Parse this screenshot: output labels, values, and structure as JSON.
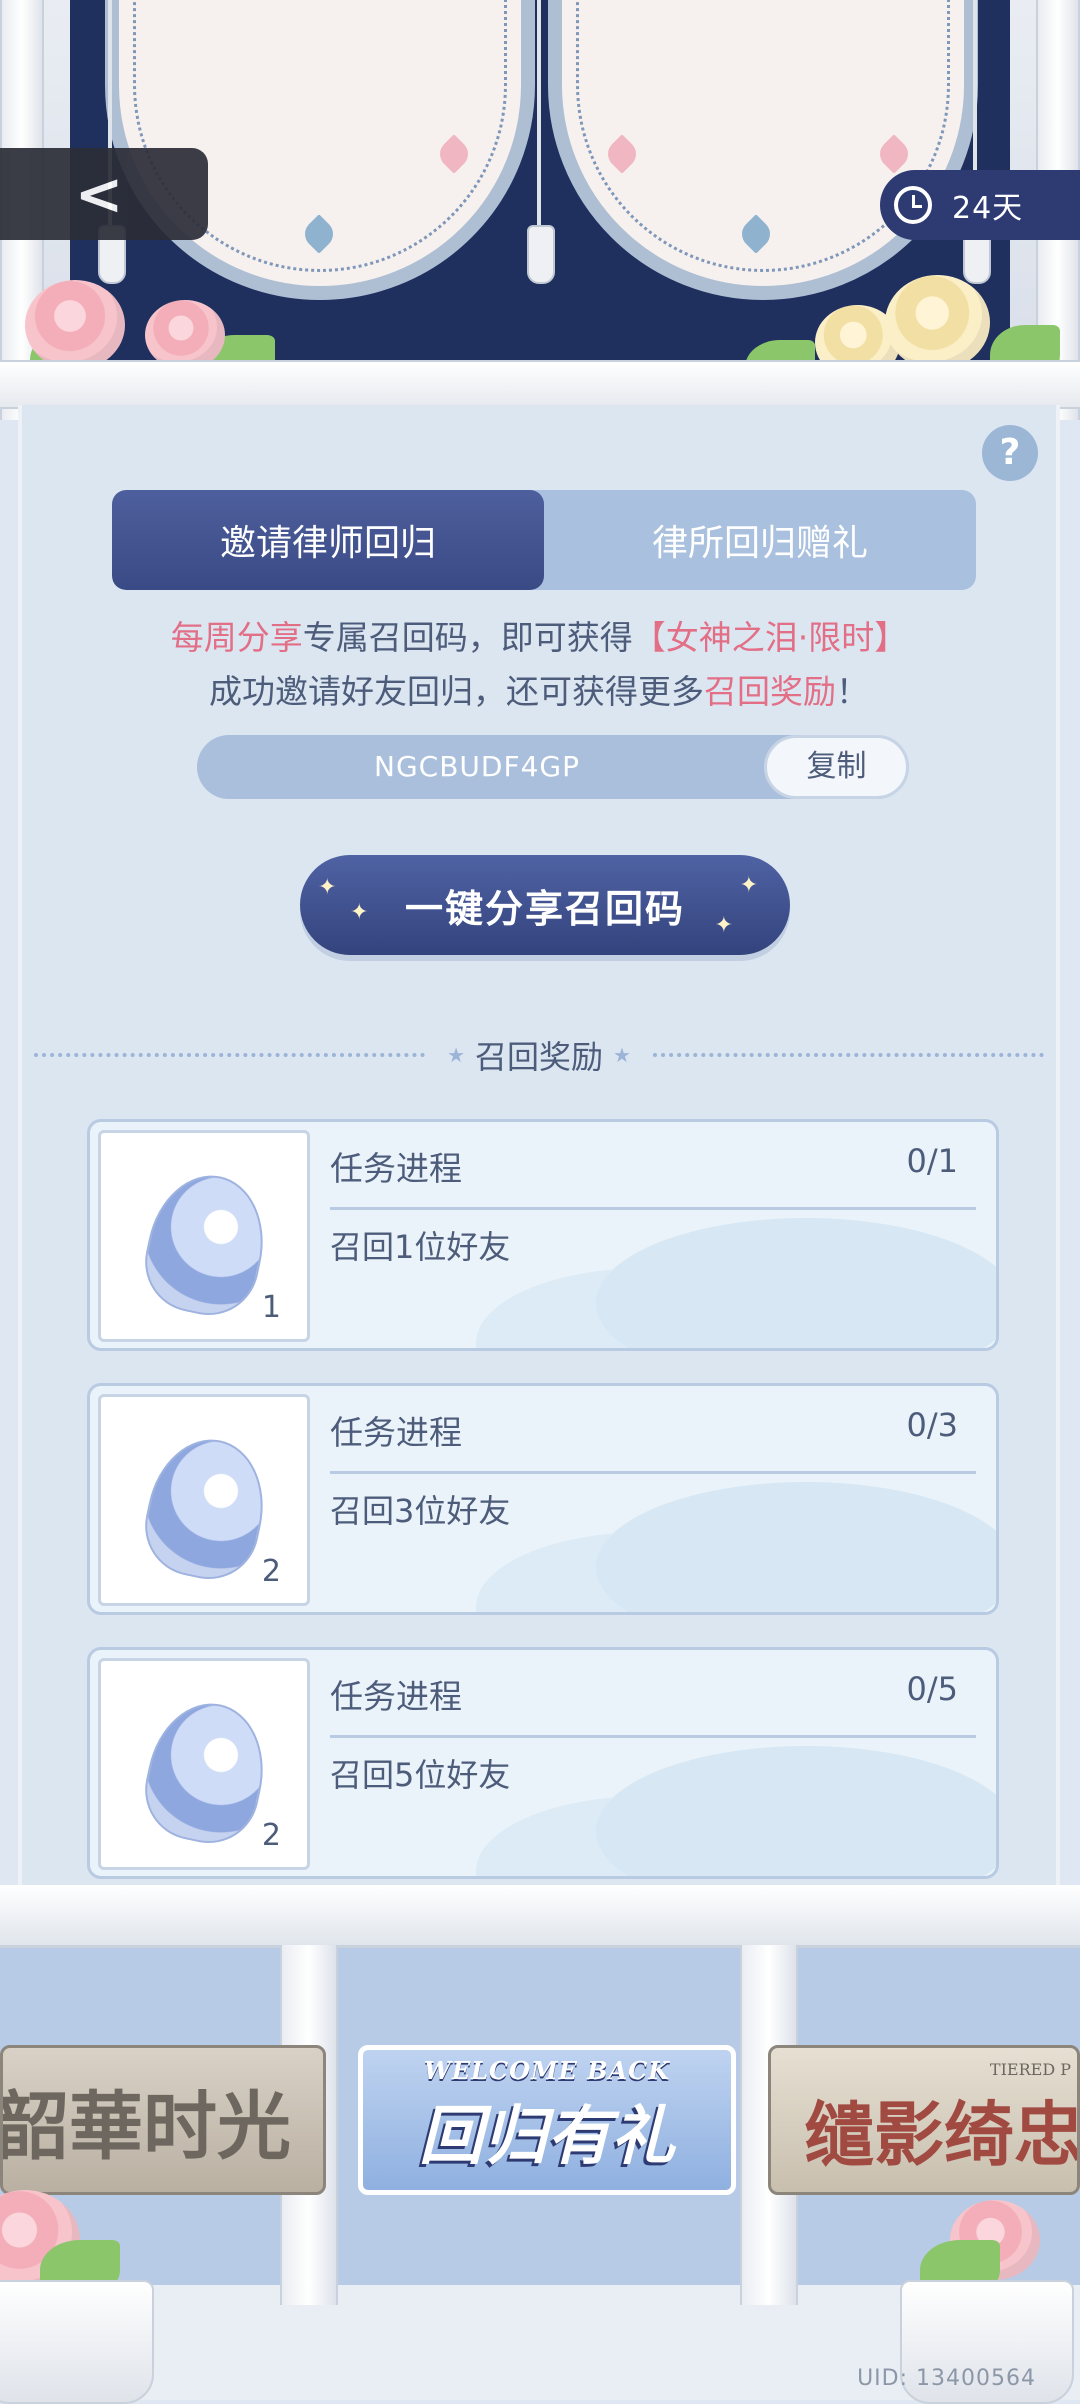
{
  "header": {
    "back_label": "<",
    "timer_text": "24天"
  },
  "panel": {
    "help_label": "?",
    "tabs": [
      {
        "label": "邀请律师回归"
      },
      {
        "label": "律所回归赠礼"
      }
    ],
    "message_line1": {
      "part1": "每周分享",
      "part2": "专属召回码，即可获得",
      "part3": "【女神之泪·限时】"
    },
    "message_line2": {
      "part1": "成功邀请好友回归，还可获得更多",
      "part2": "召回奖励",
      "part3": "！"
    },
    "recall_code": "NGCBUDF4GP",
    "copy_label": "复制",
    "share_button_label": "一键分享召回码",
    "rewards_title": "召回奖励",
    "tasks": [
      {
        "title": "任务进程",
        "progress": "0/1",
        "description": "召回1位好友",
        "count": "1"
      },
      {
        "title": "任务进程",
        "progress": "0/3",
        "description": "召回3位好友",
        "count": "2"
      },
      {
        "title": "任务进程",
        "progress": "0/5",
        "description": "召回5位好友",
        "count": "2"
      }
    ]
  },
  "banners": {
    "left": "韶華时光",
    "middle_top": "WELCOME BACK",
    "middle_main": "回归有礼",
    "right_small": "TIERED P",
    "right_main": "缱影绮忠"
  },
  "uid_text": "UID: 13400564",
  "colors": {
    "navy": "#3a4a85",
    "pink_text": "#e36f87",
    "panel_bg": "#dbe6f1",
    "text": "#4d5c7a"
  }
}
